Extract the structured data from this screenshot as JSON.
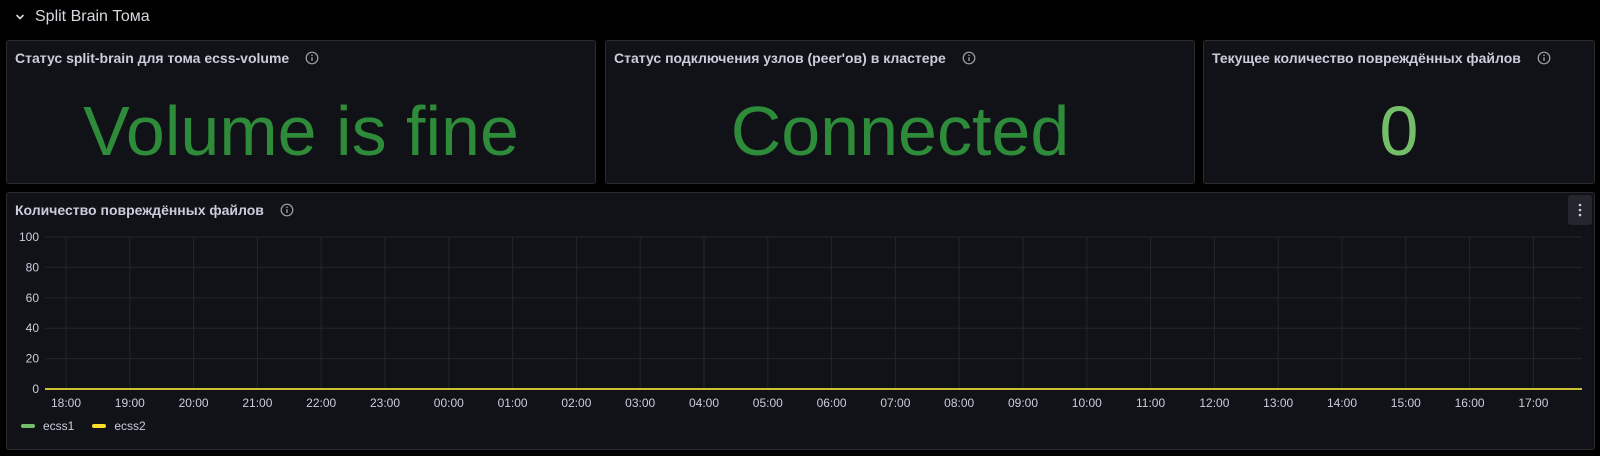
{
  "row": {
    "title": "Split Brain Тома",
    "icon": "chevron-down-icon"
  },
  "stat_panels": [
    {
      "title": "Статус split-brain для тома ecss-volume",
      "value": "Volume is fine",
      "color": "#2e8b3a"
    },
    {
      "title": "Статус подключения узлов (peer'ов) в кластере",
      "value": "Connected",
      "color": "#2e8b3a"
    },
    {
      "title": "Текущее количество повреждённых файлов",
      "value": "0",
      "color": "#73bf69"
    }
  ],
  "graph_panel": {
    "title": "Количество повреждённых файлов",
    "legend": [
      {
        "name": "ecss1",
        "color": "#73bf69"
      },
      {
        "name": "ecss2",
        "color": "#fade2a"
      }
    ]
  },
  "chart_data": {
    "type": "line",
    "title": "Количество повреждённых файлов",
    "xlabel": "",
    "ylabel": "",
    "ylim": [
      0,
      100
    ],
    "yticks": [
      0,
      20,
      40,
      60,
      80,
      100
    ],
    "x": [
      "18:00",
      "19:00",
      "20:00",
      "21:00",
      "22:00",
      "23:00",
      "00:00",
      "01:00",
      "02:00",
      "03:00",
      "04:00",
      "05:00",
      "06:00",
      "07:00",
      "08:00",
      "09:00",
      "10:00",
      "11:00",
      "12:00",
      "13:00",
      "14:00",
      "15:00",
      "16:00",
      "17:00"
    ],
    "series": [
      {
        "name": "ecss1",
        "color": "#73bf69",
        "values": [
          0,
          0,
          0,
          0,
          0,
          0,
          0,
          0,
          0,
          0,
          0,
          0,
          0,
          0,
          0,
          0,
          0,
          0,
          0,
          0,
          0,
          0,
          0,
          0
        ]
      },
      {
        "name": "ecss2",
        "color": "#fade2a",
        "values": [
          0,
          0,
          0,
          0,
          0,
          0,
          0,
          0,
          0,
          0,
          0,
          0,
          0,
          0,
          0,
          0,
          0,
          0,
          0,
          0,
          0,
          0,
          0,
          0
        ]
      }
    ],
    "grid": true,
    "legend_position": "bottom-left"
  }
}
